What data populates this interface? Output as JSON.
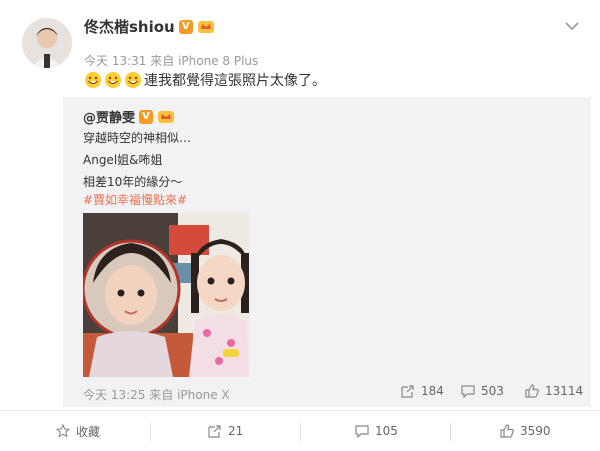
{
  "post": {
    "author_name": "佟杰楷shiou",
    "verified_badge": "V",
    "time": "今天 13:31",
    "source_prefix": "来自",
    "source_device": "iPhone 8 Plus",
    "text": "連我都覺得這張照片太像了。",
    "emoji_count": 3
  },
  "repost": {
    "author_name": "@贾静雯",
    "verified_badge": "V",
    "line1": "穿越時空的神相似…",
    "line2": "Angel姐&咘姐",
    "line3": "相差10年的緣分～",
    "hashtag": "#賈如幸福慢點來#",
    "time": "今天 13:25",
    "source_prefix": "来自",
    "source_device": "iPhone X",
    "share_count": "184",
    "comment_count": "503",
    "like_count": "13114"
  },
  "footer": {
    "favorite_label": "收藏",
    "share_count": "21",
    "comment_count": "105",
    "like_count": "3590"
  },
  "colors": {
    "accent_orange": "#eb7350",
    "badge_orange": "#f59b22",
    "muted_text": "#999999",
    "repost_bg": "#f2f2f5"
  },
  "icons": [
    "chevron-down-icon",
    "verified-icon",
    "crown-icon",
    "smile-emoji-icon",
    "share-icon",
    "comment-icon",
    "like-icon",
    "star-icon"
  ]
}
